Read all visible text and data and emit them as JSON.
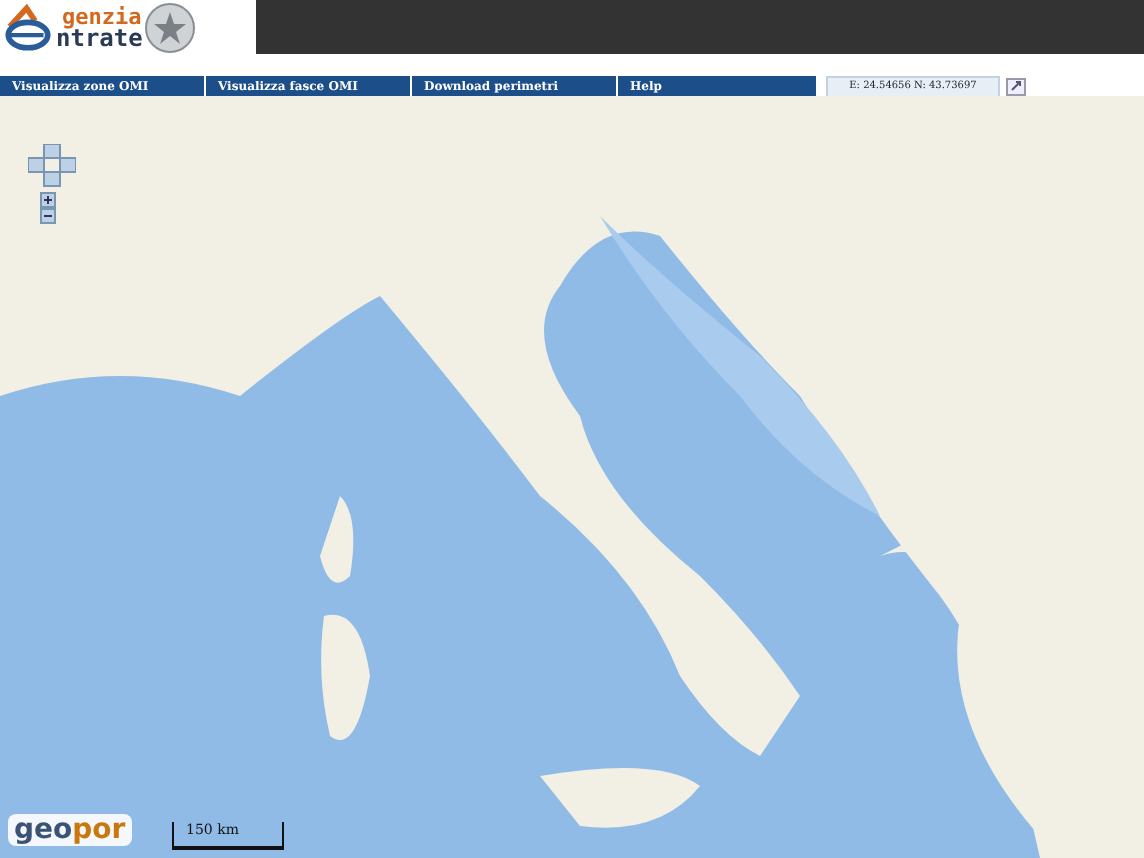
{
  "header": {
    "logo_top": "genzia",
    "logo_bottom": "ntrate"
  },
  "nav": {
    "items": [
      {
        "label": "Visualizza zone OMI"
      },
      {
        "label": "Visualizza fasce OMI"
      },
      {
        "label": "Download perimetri"
      },
      {
        "label": "Help"
      }
    ],
    "coordinates": "E: 24.54656  N: 43.73697"
  },
  "map": {
    "logo_parts": [
      "geo",
      "por"
    ],
    "scale": "150 km"
  }
}
